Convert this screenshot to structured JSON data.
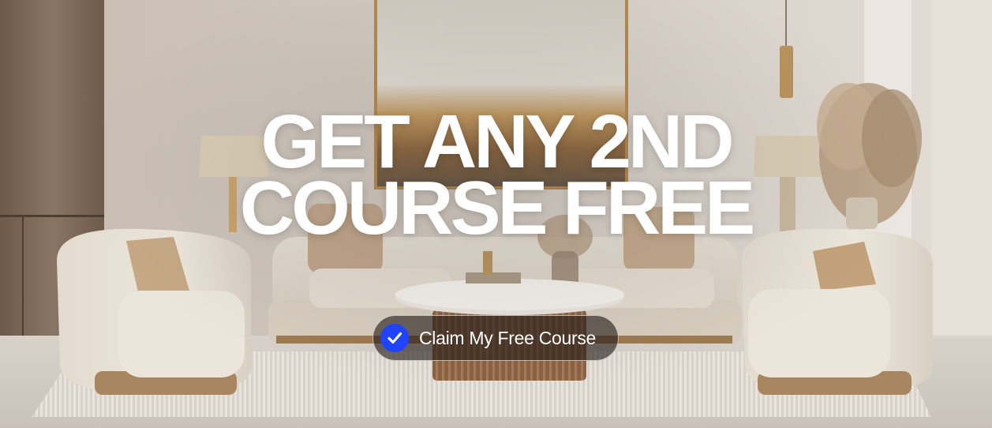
{
  "banner": {
    "headline_line1": "GET ANY 2ND",
    "headline_line2": "COURSE FREE",
    "cta_label": "Claim My Free Course",
    "cta_icon": "checkmark-icon",
    "accent_color": "#1f43ff",
    "background_scene": "living-room-photo"
  }
}
